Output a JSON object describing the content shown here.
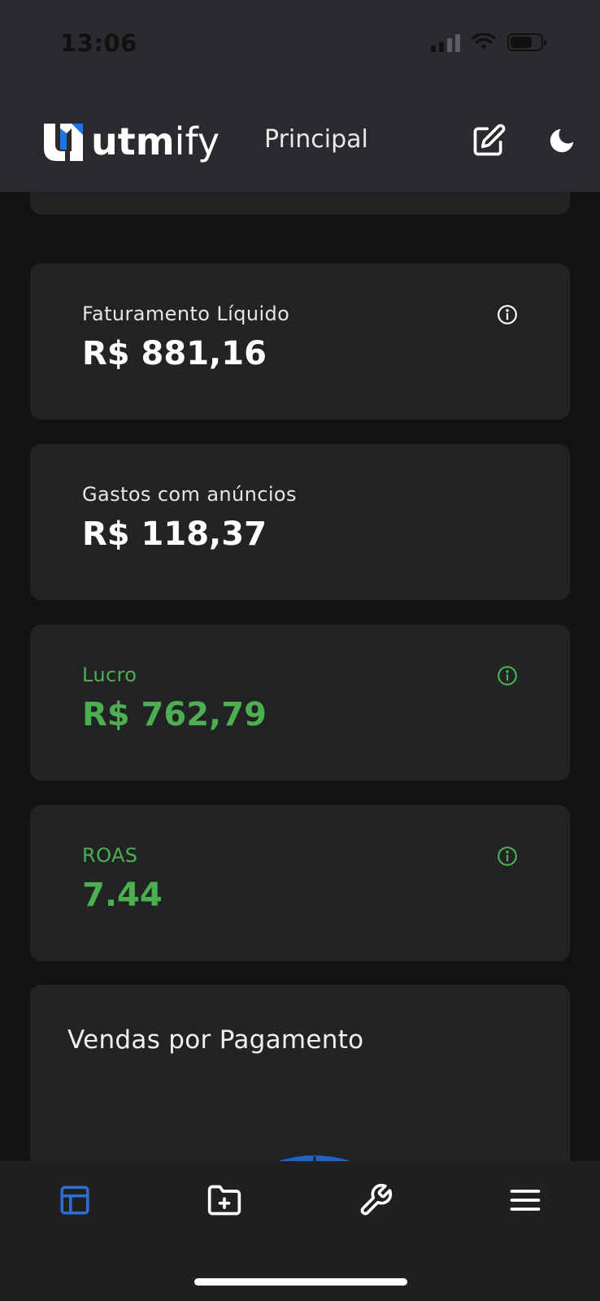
{
  "status": {
    "time": "13:06"
  },
  "header": {
    "logo_bold": "utm",
    "logo_light": "ify",
    "title": "Principal",
    "edit_icon": "edit-icon",
    "theme_icon": "moon-icon"
  },
  "cards": {
    "net_revenue": {
      "label": "Faturamento Líquido",
      "value": "R$ 881,16",
      "icon": "info-icon"
    },
    "ad_spend": {
      "label": "Gastos com anúncios",
      "value": "R$ 118,37"
    },
    "profit": {
      "label": "Lucro",
      "value": "R$ 762,79",
      "icon": "info-icon"
    },
    "roas": {
      "label": "ROAS",
      "value": "7.44",
      "icon": "info-icon"
    }
  },
  "sales_by_payment": {
    "title": "Vendas por Pagamento"
  },
  "bottom_nav": {
    "items": [
      {
        "icon": "dashboard-icon",
        "active": true
      },
      {
        "icon": "folder-plus-icon",
        "active": false
      },
      {
        "icon": "wrench-icon",
        "active": false
      },
      {
        "icon": "menu-icon",
        "active": false
      }
    ]
  },
  "colors": {
    "background": "#131313",
    "header": "#2a2b2e",
    "card": "#222324",
    "positive": "#4caf50",
    "accent": "#2f6fd1"
  }
}
